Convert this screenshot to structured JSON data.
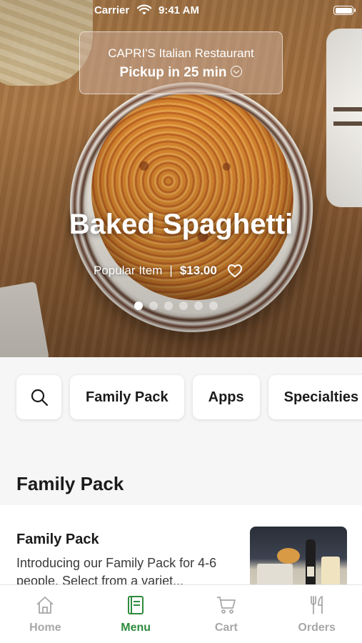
{
  "status_bar": {
    "carrier": "Carrier",
    "time": "9:41 AM"
  },
  "restaurant": {
    "name": "CAPRI'S Italian Restaurant",
    "pickup": "Pickup in 25 min"
  },
  "featured": {
    "title": "Baked Spaghetti",
    "tag": "Popular Item",
    "separator": "|",
    "price": "$13.00",
    "carousel_total": 6,
    "carousel_active": 1
  },
  "categories": [
    "Family Pack",
    "Apps",
    "Specialties"
  ],
  "section": {
    "title": "Family Pack"
  },
  "menu_item": {
    "name": "Family Pack",
    "description": "Introducing our Family Pack for 4-6 people. Select from a variet..."
  },
  "tabs": [
    {
      "label": "Home",
      "icon": "home-icon"
    },
    {
      "label": "Menu",
      "icon": "menu-book-icon"
    },
    {
      "label": "Cart",
      "icon": "cart-icon"
    },
    {
      "label": "Orders",
      "icon": "fork-knife-icon"
    }
  ],
  "colors": {
    "accent": "#2e8b3d",
    "inactive": "#a8a8a8"
  }
}
